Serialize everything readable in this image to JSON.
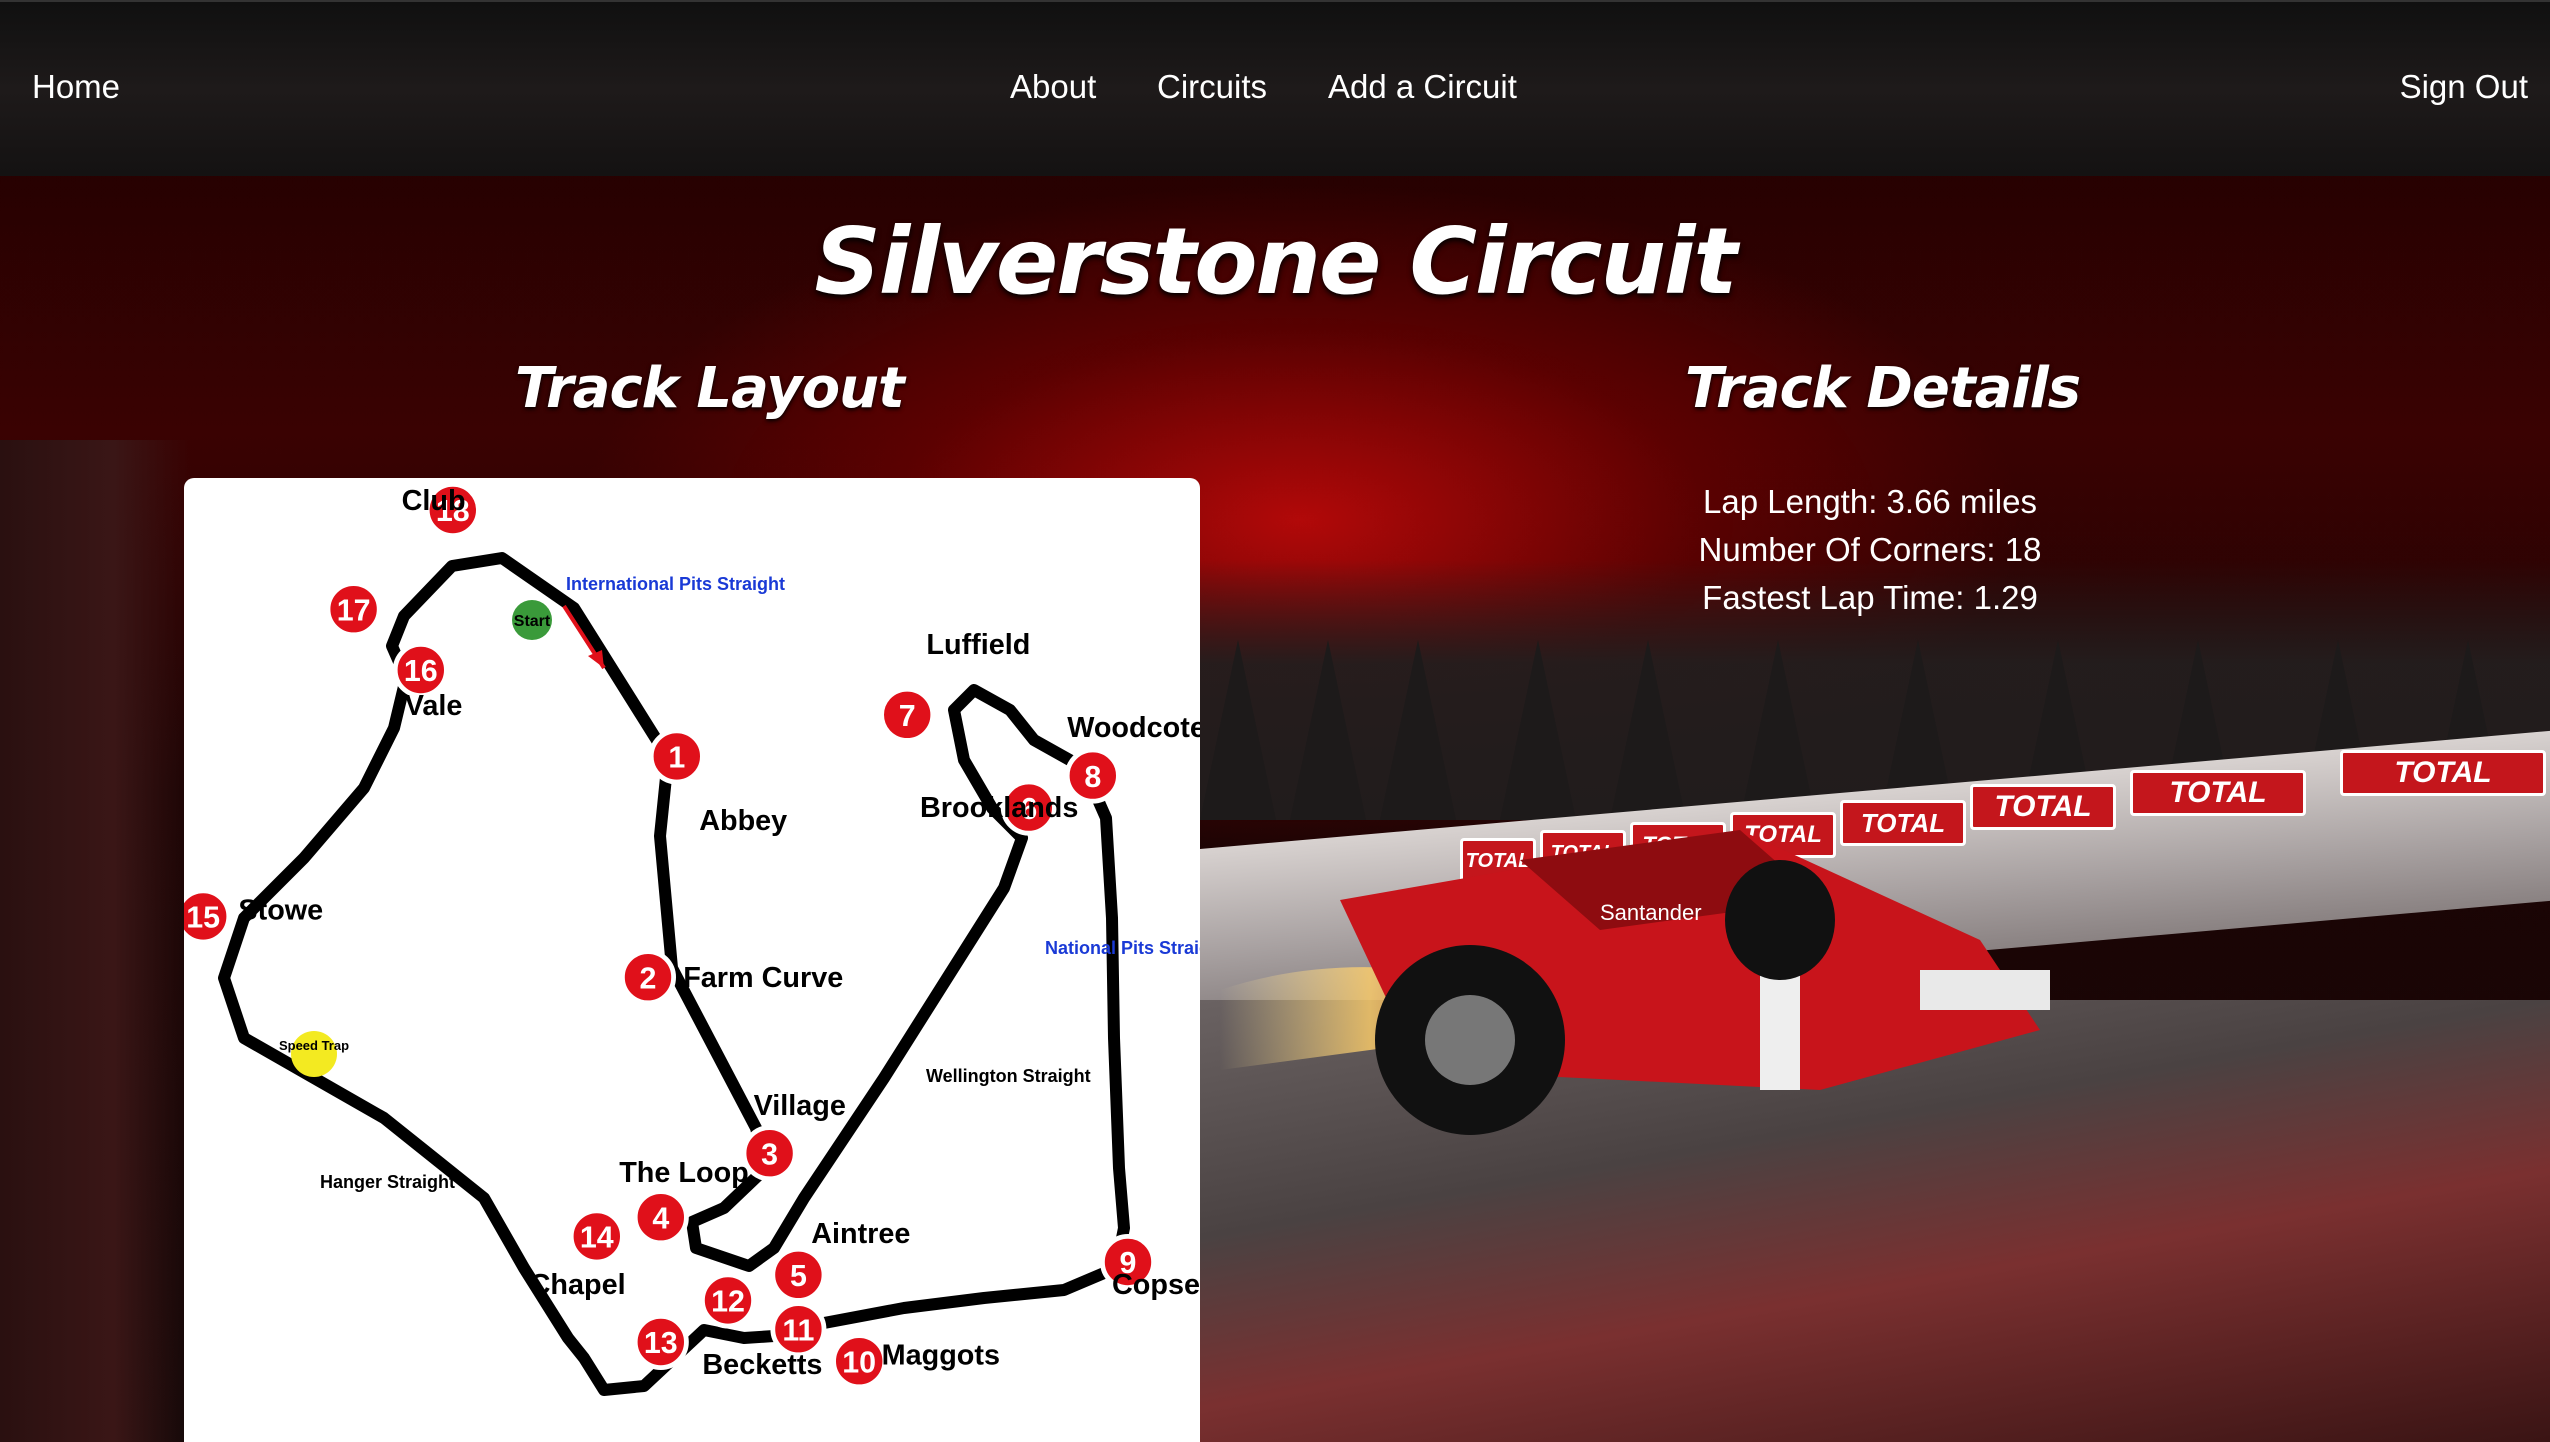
{
  "nav": {
    "home": "Home",
    "about": "About",
    "circuits": "Circuits",
    "add_circuit": "Add a Circuit",
    "sign_out": "Sign Out"
  },
  "page": {
    "title": "Silverstone Circuit",
    "layout_heading": "Track Layout",
    "details_heading": "Track Details"
  },
  "details": {
    "lap_length": "Lap Length: 3.66 miles",
    "corners": "Number Of Corners: 18",
    "fastest_lap": "Fastest Lap Time: 1.29"
  },
  "track_map": {
    "start_label": "Start",
    "speed_trap_label": "Speed Trap",
    "intl_pits": "International Pits Straight",
    "national_pits": "National Pits Straight",
    "corners": [
      {
        "num": "1",
        "name": "Abbey"
      },
      {
        "num": "2",
        "name": "Farm Curve"
      },
      {
        "num": "3",
        "name": "Village"
      },
      {
        "num": "4",
        "name": "The Loop"
      },
      {
        "num": "5",
        "name": "Aintree"
      },
      {
        "num": "6",
        "name": "Brooklands"
      },
      {
        "num": "7",
        "name": "Luffield"
      },
      {
        "num": "8",
        "name": "Woodcote"
      },
      {
        "num": "9",
        "name": "Copse"
      },
      {
        "num": "10",
        "name": "Maggots"
      },
      {
        "num": "11",
        "name": ""
      },
      {
        "num": "12",
        "name": ""
      },
      {
        "num": "13",
        "name": "Becketts"
      },
      {
        "num": "14",
        "name": "Chapel"
      },
      {
        "num": "15",
        "name": "Stowe"
      },
      {
        "num": "16",
        "name": "Vale"
      },
      {
        "num": "17",
        "name": ""
      },
      {
        "num": "18",
        "name": "Club"
      }
    ],
    "other_labels": {
      "wellington": "Wellington Straight",
      "hanger": "Hanger Straight"
    }
  },
  "background": {
    "sponsor": "TOTAL",
    "car_sponsor": "Santander"
  }
}
